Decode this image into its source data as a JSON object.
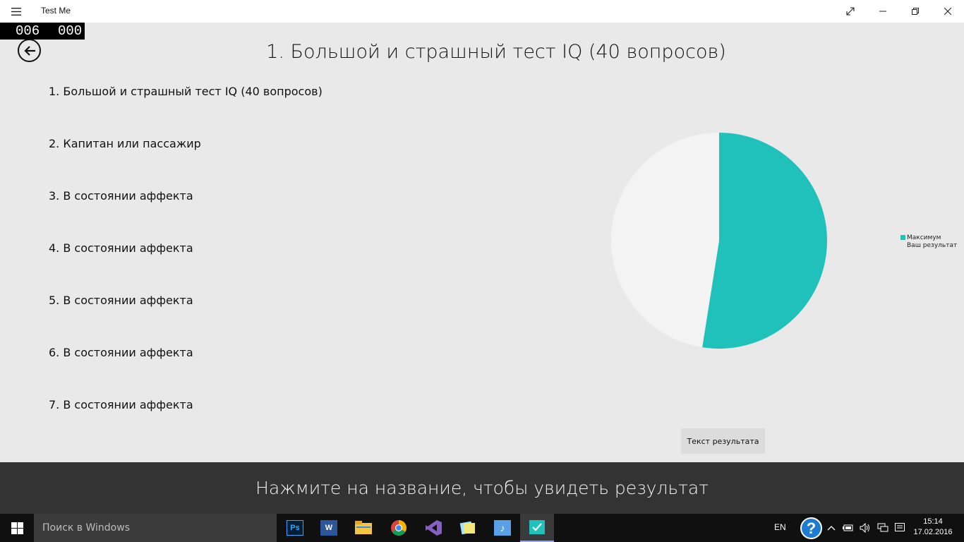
{
  "window": {
    "app_title": "Test Me"
  },
  "counter": {
    "left": "006",
    "right": "000"
  },
  "page": {
    "title": "1. Большой и страшный тест IQ (40 вопросов)"
  },
  "tests": [
    "1. Большой и страшный тест IQ (40 вопросов)",
    "2. Капитан или пассажир",
    "3. В состоянии аффекта",
    "4. В состоянии аффекта",
    "5. В состоянии аффекта",
    "6. В состоянии аффекта",
    "7. В состоянии аффекта"
  ],
  "chart_data": {
    "type": "pie",
    "title": "",
    "series": [
      {
        "name": "Максимум",
        "value": 52.5,
        "color": "#20c1bb"
      },
      {
        "name": "Ваш результат",
        "value": 47.5,
        "color": "#f3f3f3"
      }
    ],
    "start_angle_deg": 0,
    "legend_position": "right"
  },
  "result_button": {
    "label": "Текст результата"
  },
  "hint": {
    "text": "Нажмите на название, чтобы увидеть результат"
  },
  "taskbar": {
    "search_placeholder": "Поиск в Windows",
    "apps": [
      "photoshop-icon",
      "word-icon",
      "file-explorer-icon",
      "chrome-icon",
      "visual-studio-icon",
      "sticky-notes-icon",
      "music-app-icon",
      "test-me-app-icon"
    ],
    "language": "EN",
    "time": "15:14",
    "date": "17.02.2016"
  },
  "colors": {
    "accent": "#20c1bb",
    "page_bg": "#e9e9e9",
    "hint_bar": "#333333",
    "taskbar": "#101010"
  }
}
